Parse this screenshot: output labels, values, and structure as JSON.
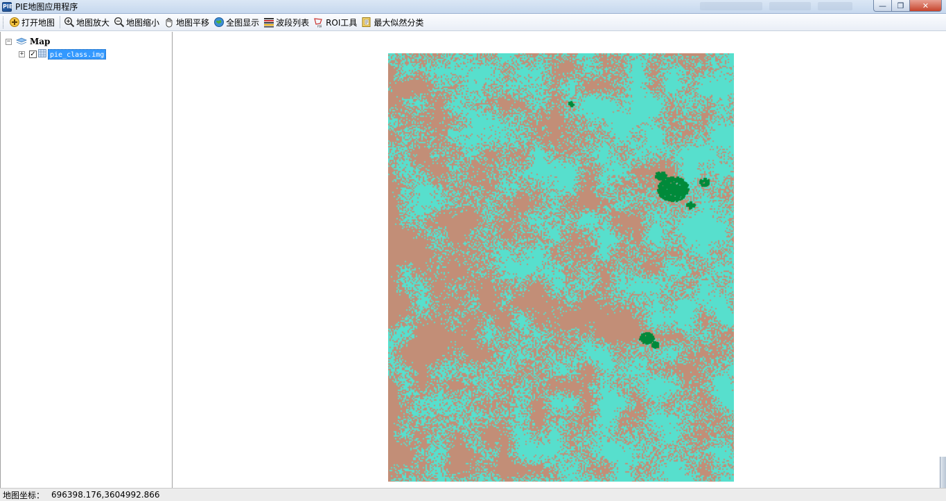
{
  "window": {
    "title": "PIE地图应用程序",
    "controls": {
      "minimize": "—",
      "maximize": "❐",
      "close": "✕"
    }
  },
  "toolbar": {
    "items": [
      {
        "label": "打开地图",
        "icon": "open-map-icon"
      },
      {
        "label": "地图放大",
        "icon": "zoom-in-icon"
      },
      {
        "label": "地图缩小",
        "icon": "zoom-out-icon"
      },
      {
        "label": "地图平移",
        "icon": "pan-hand-icon"
      },
      {
        "label": "全图显示",
        "icon": "globe-icon"
      },
      {
        "label": "波段列表",
        "icon": "band-list-icon"
      },
      {
        "label": "ROI工具",
        "icon": "roi-icon"
      },
      {
        "label": "最大似然分类",
        "icon": "classify-icon"
      }
    ]
  },
  "toc": {
    "root": {
      "label": "Map",
      "expander": "−"
    },
    "layer": {
      "label": "pie_class.img",
      "expander": "+",
      "checked": "✓"
    }
  },
  "map": {
    "colors": {
      "class1": "#c28e77",
      "class2": "#57dfcd",
      "class3": "#008a3a",
      "background": "#ffffff"
    }
  },
  "status": {
    "label": "地图坐标：",
    "coordinates": "696398.176,3604992.866"
  }
}
